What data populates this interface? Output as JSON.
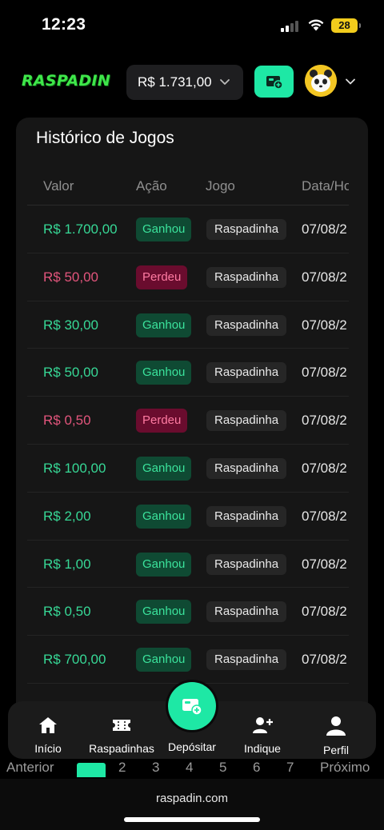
{
  "status_bar": {
    "time": "12:23",
    "battery": "28"
  },
  "header": {
    "logo": "RASPADIN",
    "balance": "R$ 1.731,00"
  },
  "history": {
    "title": "Histórico de Jogos",
    "columns": [
      "Valor",
      "Ação",
      "Jogo",
      "Data/Ho"
    ],
    "rows": [
      {
        "value": "R$ 1.700,00",
        "action": "Ganhou",
        "game": "Raspadinha",
        "date": "07/08/2"
      },
      {
        "value": "R$ 50,00",
        "action": "Perdeu",
        "game": "Raspadinha",
        "date": "07/08/2"
      },
      {
        "value": "R$ 30,00",
        "action": "Ganhou",
        "game": "Raspadinha",
        "date": "07/08/2"
      },
      {
        "value": "R$ 50,00",
        "action": "Ganhou",
        "game": "Raspadinha",
        "date": "07/08/2"
      },
      {
        "value": "R$ 0,50",
        "action": "Perdeu",
        "game": "Raspadinha",
        "date": "07/08/2"
      },
      {
        "value": "R$ 100,00",
        "action": "Ganhou",
        "game": "Raspadinha",
        "date": "07/08/2"
      },
      {
        "value": "R$ 2,00",
        "action": "Ganhou",
        "game": "Raspadinha",
        "date": "07/08/2"
      },
      {
        "value": "R$ 1,00",
        "action": "Ganhou",
        "game": "Raspadinha",
        "date": "07/08/2"
      },
      {
        "value": "R$ 0,50",
        "action": "Ganhou",
        "game": "Raspadinha",
        "date": "07/08/2"
      },
      {
        "value": "R$ 700,00",
        "action": "Ganhou",
        "game": "Raspadinha",
        "date": "07/08/2"
      }
    ]
  },
  "pagination": {
    "previous": "Anterior",
    "pages": [
      "1",
      "2",
      "3",
      "4",
      "5",
      "6",
      "7"
    ],
    "next": "Próximo"
  },
  "bottom_nav": {
    "items": [
      {
        "label": "Início",
        "icon": "home-icon"
      },
      {
        "label": "Raspadinhas",
        "icon": "ticket-icon"
      },
      {
        "label": "Depósitar",
        "icon": "deposit-icon"
      },
      {
        "label": "Indique",
        "icon": "add-user-icon"
      },
      {
        "label": "Perfil",
        "icon": "user-icon"
      }
    ]
  },
  "browser": {
    "url": "raspadin.com"
  },
  "colors": {
    "accent": "#1ee8a5",
    "win": "#37d896",
    "lose": "#e2557c",
    "card": "#161616",
    "background": "#000000"
  }
}
